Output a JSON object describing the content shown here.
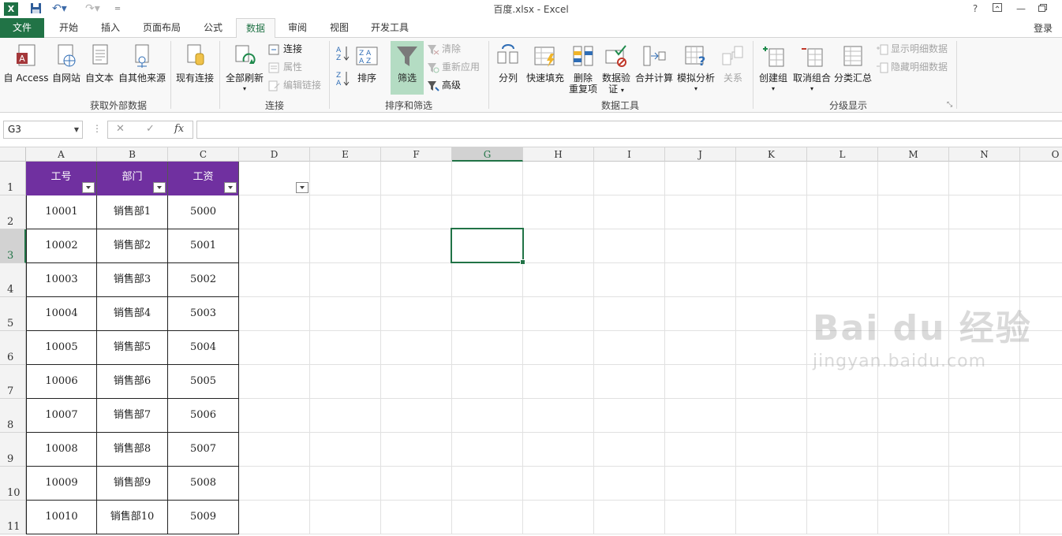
{
  "window": {
    "title": "百度.xlsx - Excel",
    "help": "?",
    "login": "登录"
  },
  "tabs": [
    "文件",
    "开始",
    "插入",
    "页面布局",
    "公式",
    "数据",
    "审阅",
    "视图",
    "开发工具"
  ],
  "ribbon": {
    "get_external": {
      "label": "获取外部数据",
      "access": "自 Access",
      "web": "自网站",
      "text": "自文本",
      "other": "自其他来源",
      "existing": "现有连接"
    },
    "connections": {
      "label": "连接",
      "refresh_all": "全部刷新",
      "connections": "连接",
      "properties": "属性",
      "edit_links": "编辑链接"
    },
    "sort_filter": {
      "label": "排序和筛选",
      "sort": "排序",
      "filter": "筛选",
      "clear": "清除",
      "reapply": "重新应用",
      "advanced": "高级"
    },
    "data_tools": {
      "label": "数据工具",
      "text_to_columns": "分列",
      "flash_fill": "快速填充",
      "remove_dup_1": "删除",
      "remove_dup_2": "重复项",
      "validation_1": "数据验",
      "validation_2": "证",
      "consolidate": "合并计算",
      "what_if": "模拟分析",
      "relationships": "关系"
    },
    "outline": {
      "label": "分级显示",
      "group": "创建组",
      "ungroup": "取消组合",
      "subtotal": "分类汇总",
      "show_detail": "显示明细数据",
      "hide_detail": "隐藏明细数据"
    }
  },
  "formula_bar": {
    "name_box": "G3",
    "fx": "fx",
    "formula": ""
  },
  "columns": [
    "A",
    "B",
    "C",
    "D",
    "E",
    "F",
    "G",
    "H",
    "I",
    "J",
    "K",
    "L",
    "M",
    "N",
    "O"
  ],
  "rows": [
    "1",
    "2",
    "3",
    "4",
    "5",
    "6",
    "7",
    "8",
    "9",
    "10",
    "11"
  ],
  "table": {
    "headers": [
      "工号",
      "部门",
      "工资"
    ],
    "rows": [
      [
        "10001",
        "销售部1",
        "5000"
      ],
      [
        "10002",
        "销售部2",
        "5001"
      ],
      [
        "10003",
        "销售部3",
        "5002"
      ],
      [
        "10004",
        "销售部4",
        "5003"
      ],
      [
        "10005",
        "销售部5",
        "5004"
      ],
      [
        "10006",
        "销售部6",
        "5005"
      ],
      [
        "10007",
        "销售部7",
        "5006"
      ],
      [
        "10008",
        "销售部8",
        "5007"
      ],
      [
        "10009",
        "销售部9",
        "5008"
      ],
      [
        "10010",
        "销售部10",
        "5009"
      ]
    ]
  },
  "watermark": {
    "brand": "Bai du 经验",
    "url": "jingyan.baidu.com"
  },
  "colors": {
    "excel_green": "#217346",
    "header_purple": "#7030a0",
    "filter_highlight": "#b4dcc3"
  }
}
